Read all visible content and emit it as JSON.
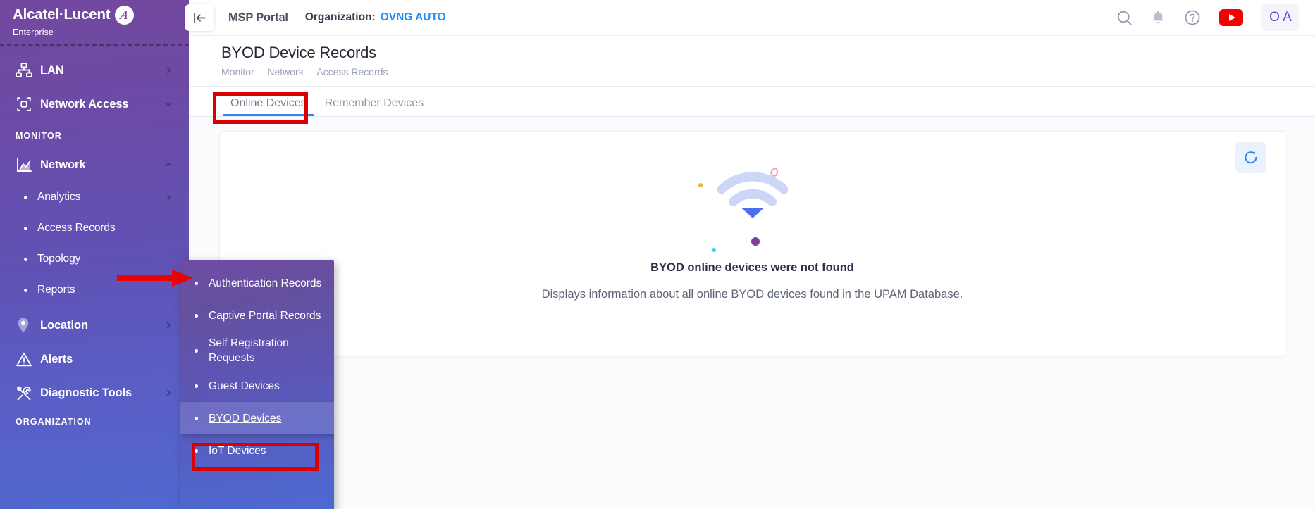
{
  "brand": {
    "name": "Alcatel·Lucent",
    "subtitle": "Enterprise",
    "logo_icon": "alcatel-lucent-logo-icon"
  },
  "topbar": {
    "collapse_icon": "collapse-sidebar-icon",
    "title": "MSP Portal",
    "organization_label": "Organization:",
    "organization_value": "OVNG AUTO",
    "actions": [
      {
        "name": "search-icon",
        "label": "Search"
      },
      {
        "name": "notification-bell-icon",
        "label": "Notifications"
      },
      {
        "name": "help-circle-icon",
        "label": "Help"
      },
      {
        "name": "youtube-icon",
        "label": "YouTube"
      }
    ],
    "avatar_initials": "O A"
  },
  "page": {
    "title": "BYOD Device Records",
    "breadcrumb": [
      "Monitor",
      "Network",
      "Access Records"
    ],
    "breadcrumb_separator": "-"
  },
  "tabs": [
    {
      "label": "Online Devices",
      "active": true
    },
    {
      "label": "Remember Devices",
      "active": false
    }
  ],
  "card": {
    "refresh_icon": "refresh-icon",
    "empty_icon": "wifi-signal-icon",
    "empty_title": "BYOD online devices were not found",
    "empty_subtitle": "Displays information about all online BYOD devices found in the UPAM Database."
  },
  "sidebar": {
    "items": [
      {
        "label": "LAN",
        "icon": "lan-network-icon",
        "chevron": "chevron-right",
        "type": "top"
      },
      {
        "label": "Network Access",
        "icon": "network-access-icon",
        "chevron": "chevron-down",
        "type": "top"
      }
    ],
    "monitor_section": "MONITOR",
    "monitor_items": [
      {
        "label": "Network",
        "icon": "analytics-chart-icon",
        "chevron": "chevron-up",
        "type": "top",
        "expanded": true
      },
      {
        "label": "Analytics",
        "type": "sub",
        "chevron": "chevron-right"
      },
      {
        "label": "Access Records",
        "type": "sub",
        "chevron": ""
      },
      {
        "label": "Topology",
        "type": "sub",
        "chevron": ""
      },
      {
        "label": "Reports",
        "type": "sub",
        "chevron": ""
      },
      {
        "label": "Location",
        "icon": "location-pin-icon",
        "chevron": "chevron-right",
        "type": "top"
      },
      {
        "label": "Alerts",
        "icon": "alert-triangle-icon",
        "chevron": "",
        "type": "top"
      },
      {
        "label": "Diagnostic Tools",
        "icon": "diagnostic-tools-icon",
        "chevron": "chevron-right",
        "type": "top"
      }
    ],
    "organization_section": "ORGANIZATION"
  },
  "flyout": {
    "items": [
      {
        "label": "Authentication Records",
        "selected": false
      },
      {
        "label": "Captive Portal Records",
        "selected": false
      },
      {
        "label": "Self Registration Requests",
        "selected": false
      },
      {
        "label": "Guest Devices",
        "selected": false
      },
      {
        "label": "BYOD Devices",
        "selected": true
      },
      {
        "label": "IoT Devices",
        "selected": false
      }
    ]
  },
  "annotations": {
    "highlight_color": "#d80000",
    "arrow_target": "Access Records",
    "boxes": [
      "Online Devices tab",
      "BYOD Devices menu item"
    ]
  },
  "colors": {
    "sidebar_top": "#74489f",
    "sidebar_bottom": "#4f68cf",
    "accent_blue": "#2f87f5",
    "link_blue": "#1e8ef7",
    "avatar_purple": "#6e3fd8",
    "youtube_red": "#f60000"
  }
}
